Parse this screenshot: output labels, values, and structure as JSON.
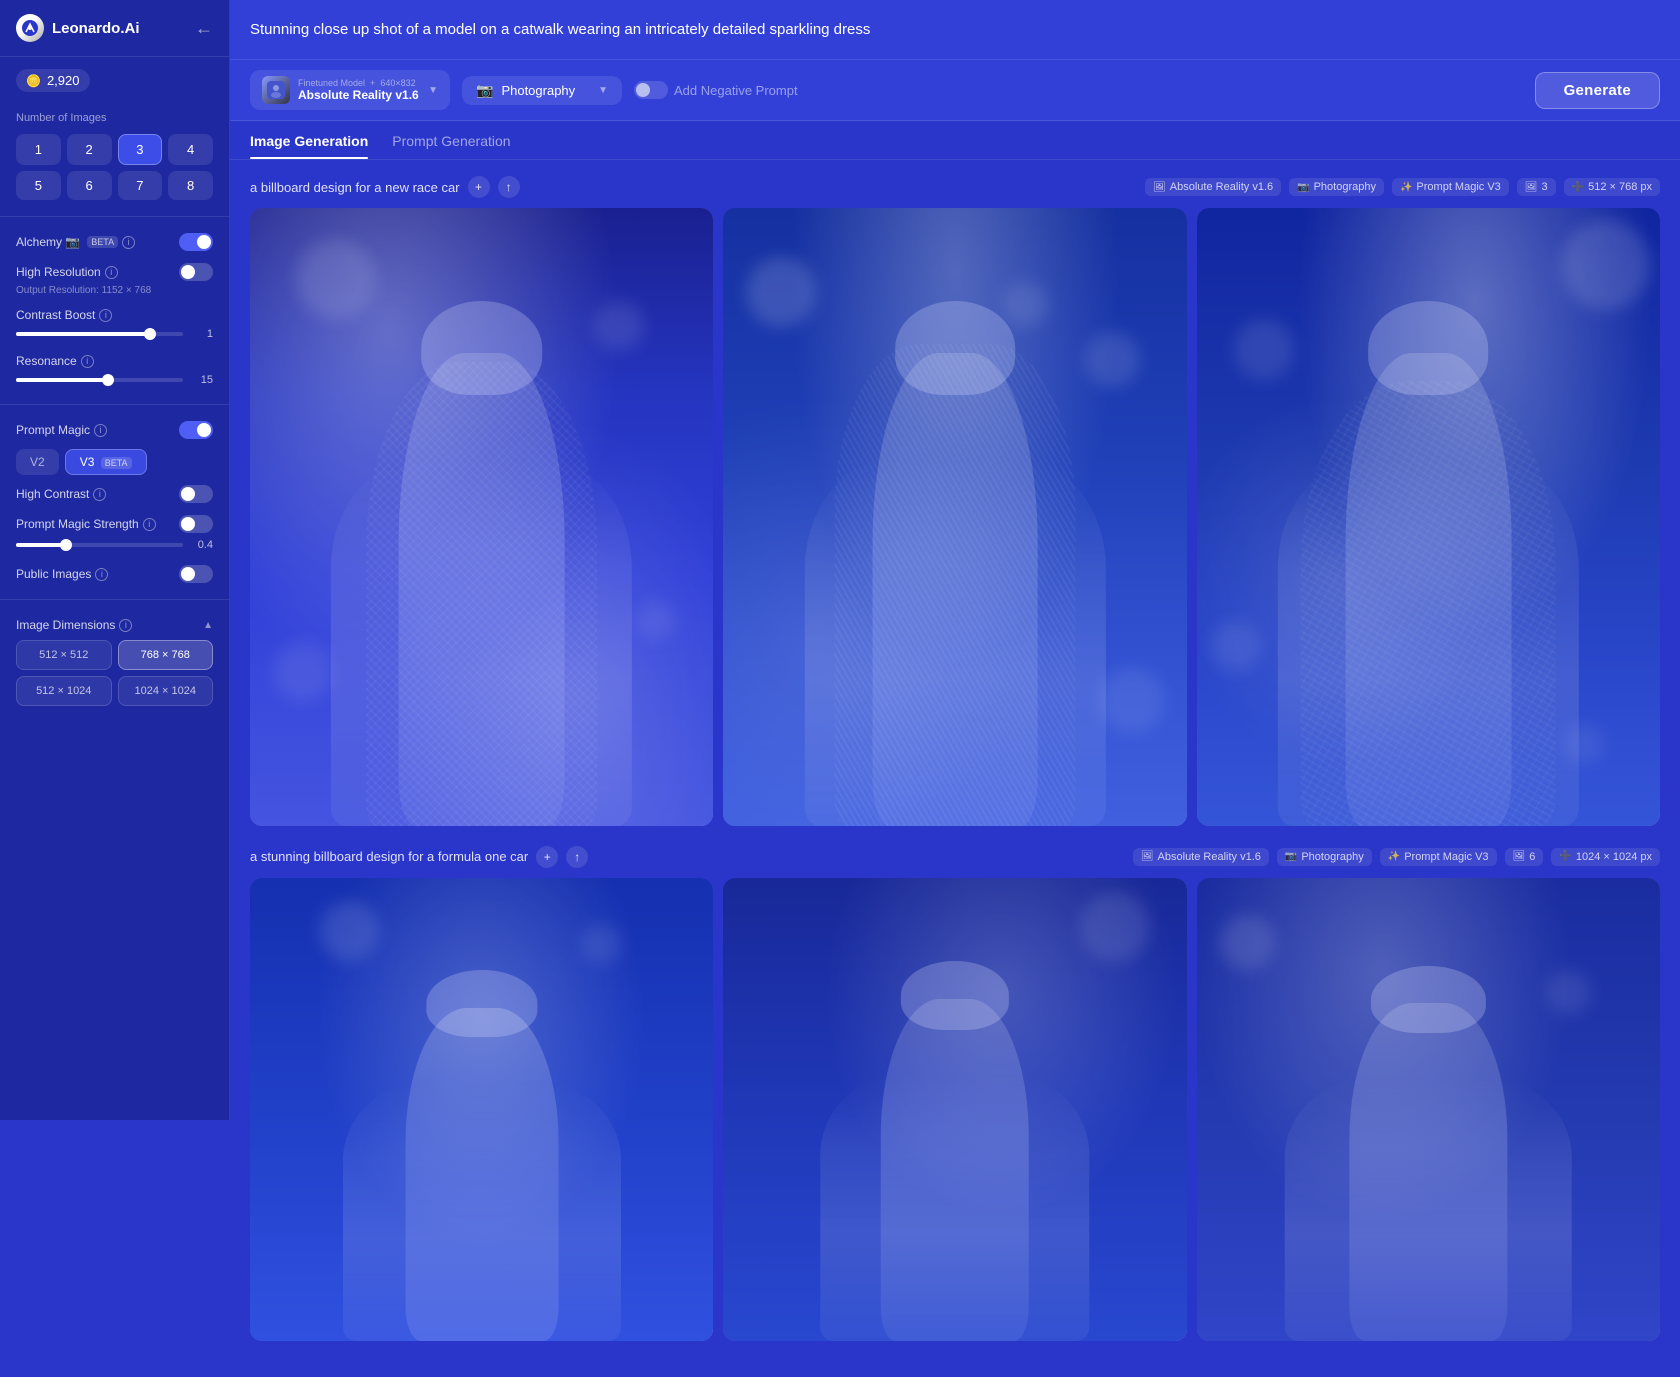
{
  "app": {
    "name": "Leonardo.Ai",
    "back_label": "←"
  },
  "sidebar": {
    "token_count": "2,920",
    "token_icon": "🪙",
    "number_of_images_label": "Number of Images",
    "count_buttons": [
      1,
      2,
      3,
      4,
      5,
      6,
      7,
      8
    ],
    "active_count": 3,
    "settings": [
      {
        "key": "photoreal_alchemy",
        "label": "Alchemy",
        "badge": "BETA",
        "type": "toggle",
        "enabled": true
      },
      {
        "key": "high_resolution",
        "label": "High Resolution",
        "sub": "Output Resolution: 1152 × 768",
        "type": "toggle",
        "enabled": false
      },
      {
        "key": "contrast_boost",
        "label": "Contrast Boost",
        "type": "slider",
        "value": 1,
        "fill_percent": 80
      },
      {
        "key": "resonance",
        "label": "Resonance",
        "type": "slider",
        "value": 15,
        "fill_percent": 55
      },
      {
        "key": "prompt_magic",
        "label": "Prompt Magic",
        "type": "toggle",
        "enabled": true,
        "versions": [
          "V2",
          "V3"
        ],
        "active_version": "V3",
        "v3_beta": true
      },
      {
        "key": "high_contrast",
        "label": "High Contrast",
        "type": "toggle",
        "enabled": false
      },
      {
        "key": "prompt_magic_strength",
        "label": "Prompt Magic Strength",
        "type": "slider",
        "value": 0.4,
        "fill_percent": 30,
        "has_toggle": true,
        "toggle_enabled": false
      },
      {
        "key": "public_images",
        "label": "Public Images",
        "type": "toggle",
        "enabled": false
      }
    ],
    "image_dimensions_label": "Image Dimensions",
    "dimension_buttons": [
      "512 × 512",
      "768 × 768",
      "512 × 1024",
      "1024 × 1024"
    ],
    "active_dimension": "768 × 768"
  },
  "header": {
    "prompt_text": "Stunning close up shot of a model on a catwalk wearing an intricately detailed sparkling dress",
    "model": {
      "type": "Finetuned Model",
      "name": "Absolute Reality v1.6",
      "size": "640×832"
    },
    "style": {
      "label": "Photography",
      "icon": "📷"
    },
    "negative_prompt_label": "Add Negative Prompt",
    "generate_label": "Generate"
  },
  "tabs": [
    {
      "key": "image_generation",
      "label": "Image Generation",
      "active": true
    },
    {
      "key": "prompt_generation",
      "label": "Prompt Generation",
      "active": false
    }
  ],
  "generations": [
    {
      "id": "gen1",
      "prompt": "a billboard design for a new race car",
      "tags": [
        {
          "label": "Absolute Reality v1.6",
          "icon": "🖼"
        },
        {
          "label": "Photography",
          "icon": "📷"
        },
        {
          "label": "Prompt Magic V3",
          "icon": "✨"
        },
        {
          "label": "3",
          "icon": "🖼"
        },
        {
          "label": "512 × 768 px",
          "icon": "➕"
        }
      ],
      "image_count": 3
    },
    {
      "id": "gen2",
      "prompt": "a stunning billboard design for a formula one car",
      "tags": [
        {
          "label": "Absolute Reality v1.6",
          "icon": "🖼"
        },
        {
          "label": "Photography",
          "icon": "📷"
        },
        {
          "label": "Prompt Magic V3",
          "icon": "✨"
        },
        {
          "label": "6",
          "icon": "🖼"
        },
        {
          "label": "1024 × 1024 px",
          "icon": "➕"
        }
      ],
      "image_count": 3
    }
  ]
}
